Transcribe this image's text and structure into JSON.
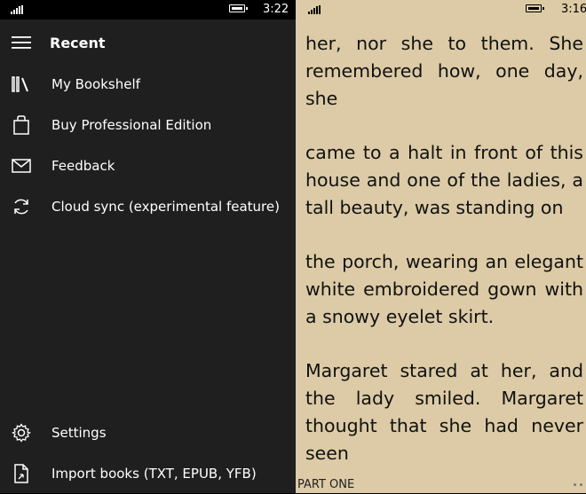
{
  "left_screen": {
    "status": {
      "time": "3:22"
    },
    "menu": {
      "header": "Recent",
      "items": [
        {
          "label": "My Bookshelf"
        },
        {
          "label": "Buy Professional Edition"
        },
        {
          "label": "Feedback"
        },
        {
          "label": "Cloud sync (experimental feature)"
        }
      ],
      "bottom_items": [
        {
          "label": "Settings"
        },
        {
          "label": "Import books (TXT,  EPUB, YFB)"
        }
      ]
    }
  },
  "right_screen": {
    "status": {
      "time": "3:16"
    },
    "paragraphs": [
      "her, nor she to them. She remembered how, one day, she",
      "came to a halt in front of this house and one of the ladies, a tall beauty, was standing on",
      "the porch, wearing an elegant white embroidered gown with a snowy eyelet skirt.",
      "Margaret stared at her, and the lady smiled. Margaret thought that she had never seen"
    ],
    "footer": "PART ONE"
  },
  "colors": {
    "drawer_bg": "#1f1f1f",
    "page_bg": "#dccba6",
    "text_dark": "#111111"
  }
}
